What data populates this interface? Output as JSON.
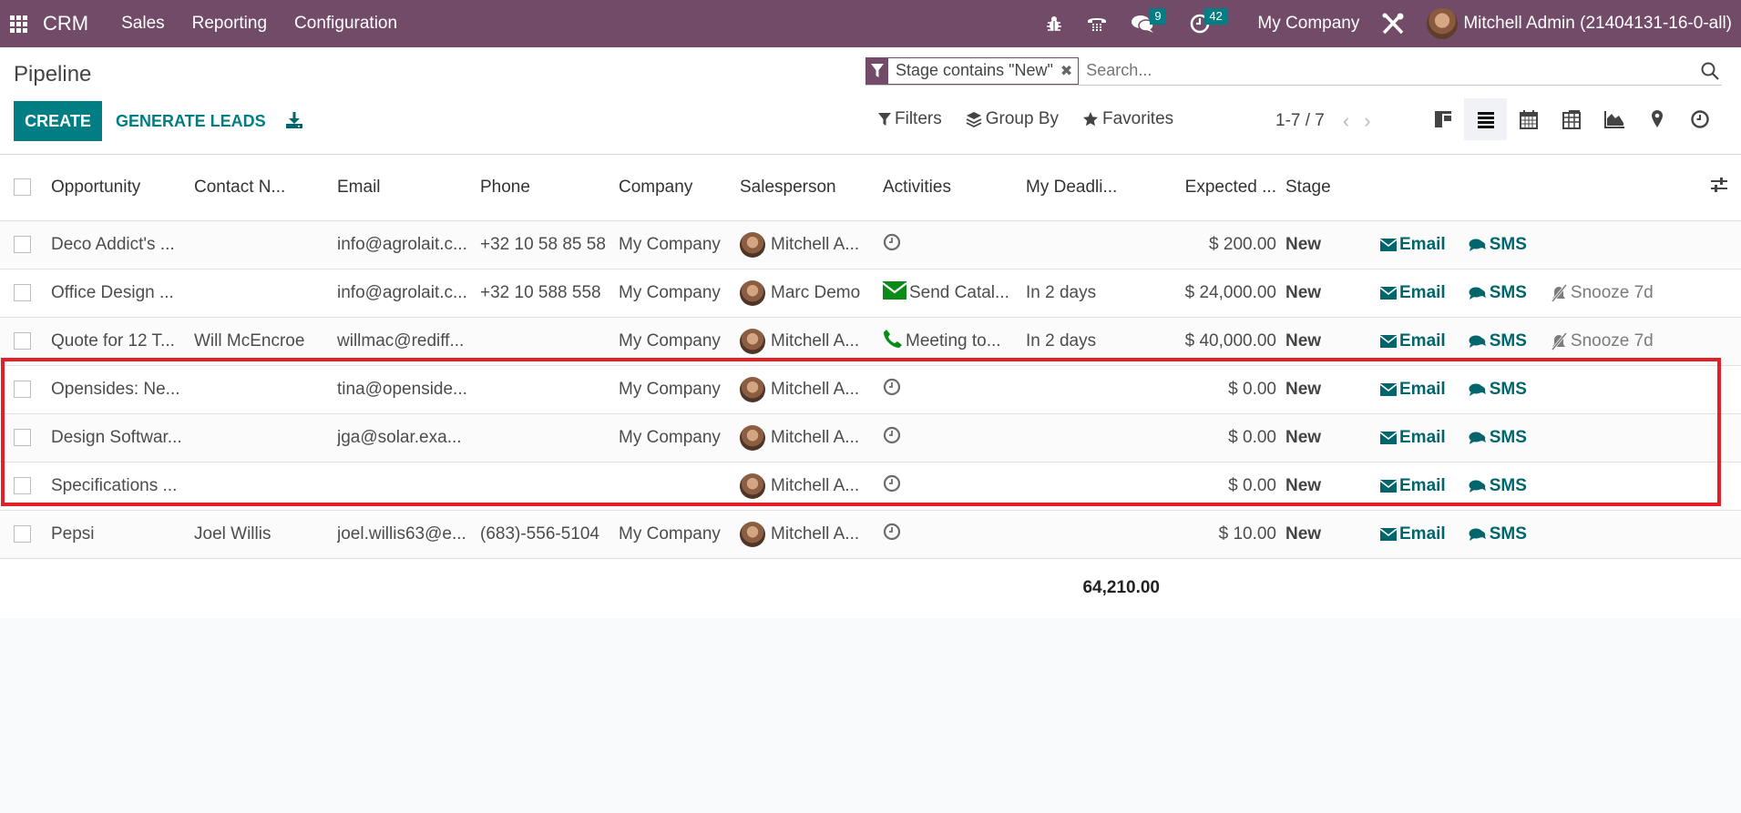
{
  "navbar": {
    "app_name": "CRM",
    "menus": [
      "Sales",
      "Reporting",
      "Configuration"
    ],
    "messages_count": "9",
    "activities_count": "42",
    "company": "My Company",
    "user": "Mitchell Admin (21404131-16-0-all)"
  },
  "control": {
    "title": "Pipeline",
    "create_label": "CREATE",
    "generate_label": "GENERATE LEADS",
    "facet_label": "Stage contains \"New\"",
    "search_placeholder": "Search...",
    "filters_label": "Filters",
    "groupby_label": "Group By",
    "favorites_label": "Favorites",
    "pager": "1-7 / 7",
    "active_view": "list"
  },
  "table": {
    "columns": [
      "Opportunity",
      "Contact N...",
      "Email",
      "Phone",
      "Company",
      "Salesperson",
      "Activities",
      "My Deadli...",
      "Expected ...",
      "Stage"
    ],
    "rows": [
      {
        "opportunity": "Deco Addict's ...",
        "contact": "",
        "email": "info@agrolait.c...",
        "phone": "+32 10 58 85 58",
        "company": "My Company",
        "salesperson": "Mitchell A...",
        "activity_icon": "clock-icon",
        "activity": "",
        "deadline": "",
        "expected": "$ 200.00",
        "stage": "New",
        "email_btn": "Email",
        "sms_btn": "SMS",
        "snooze_btn": ""
      },
      {
        "opportunity": "Office Design ...",
        "contact": "",
        "email": "info@agrolait.c...",
        "phone": "+32 10 588 558",
        "company": "My Company",
        "salesperson": "Marc Demo",
        "activity_icon": "envelope-icon",
        "activity": "Send Catal...",
        "deadline": "In 2 days",
        "expected": "$ 24,000.00",
        "stage": "New",
        "email_btn": "Email",
        "sms_btn": "SMS",
        "snooze_btn": "Snooze 7d"
      },
      {
        "opportunity": "Quote for 12 T...",
        "contact": "Will McEncroe",
        "email": "willmac@rediff...",
        "phone": "",
        "company": "My Company",
        "salesperson": "Mitchell A...",
        "activity_icon": "phone-icon",
        "activity": "Meeting to...",
        "deadline": "In 2 days",
        "expected": "$ 40,000.00",
        "stage": "New",
        "email_btn": "Email",
        "sms_btn": "SMS",
        "snooze_btn": "Snooze 7d"
      },
      {
        "opportunity": "Opensides: Ne...",
        "contact": "",
        "email": "tina@openside...",
        "phone": "",
        "company": "My Company",
        "salesperson": "Mitchell A...",
        "activity_icon": "clock-icon",
        "activity": "",
        "deadline": "",
        "expected": "$ 0.00",
        "stage": "New",
        "email_btn": "Email",
        "sms_btn": "SMS",
        "snooze_btn": ""
      },
      {
        "opportunity": "Design Softwar...",
        "contact": "",
        "email": "jga@solar.exa...",
        "phone": "",
        "company": "My Company",
        "salesperson": "Mitchell A...",
        "activity_icon": "clock-icon",
        "activity": "",
        "deadline": "",
        "expected": "$ 0.00",
        "stage": "New",
        "email_btn": "Email",
        "sms_btn": "SMS",
        "snooze_btn": ""
      },
      {
        "opportunity": "Specifications ...",
        "contact": "",
        "email": "",
        "phone": "",
        "company": "",
        "salesperson": "Mitchell A...",
        "activity_icon": "clock-icon",
        "activity": "",
        "deadline": "",
        "expected": "$ 0.00",
        "stage": "New",
        "email_btn": "Email",
        "sms_btn": "SMS",
        "snooze_btn": ""
      },
      {
        "opportunity": "Pepsi",
        "contact": "Joel Willis",
        "email": "joel.willis63@e...",
        "phone": "(683)-556-5104",
        "company": "My Company",
        "salesperson": "Mitchell A...",
        "activity_icon": "clock-icon",
        "activity": "",
        "deadline": "",
        "expected": "$ 10.00",
        "stage": "New",
        "email_btn": "Email",
        "sms_btn": "SMS",
        "snooze_btn": ""
      }
    ],
    "total_expected": "64,210.00"
  },
  "colors": {
    "navbar": "#714b67",
    "primary": "#017e84",
    "action_link": "#01666b",
    "highlight_border": "#e32027",
    "activity_green": "#0a8a16"
  }
}
